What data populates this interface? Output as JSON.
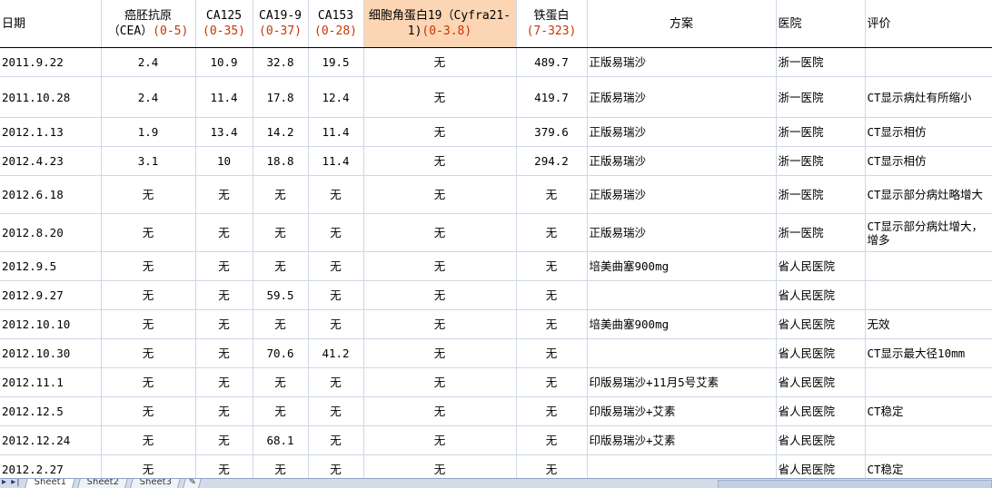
{
  "headers": {
    "date": "日期",
    "cea_line1": "癌胚抗原",
    "cea_line2_a": "（CEA）",
    "cea_line2_b": "(0-5)",
    "ca125": "CA125",
    "ca125_range": "(0-35)",
    "ca199": "CA19-9",
    "ca199_range": "(0-37)",
    "ca153": "CA153",
    "ca153_range": "(0-28)",
    "cyfra_line1": "细胞角蛋白19（Cyfra21-",
    "cyfra_line2_a": "1)",
    "cyfra_line2_b": "(0-3.8)",
    "ferritin": "铁蛋白",
    "ferritin_range": "(7-323)",
    "plan": "方案",
    "hospital": "医院",
    "evaluation": "评价"
  },
  "rows": [
    {
      "date": "2011.9.22",
      "cea": "2.4",
      "ca125": "10.9",
      "ca199": "32.8",
      "ca153": "19.5",
      "cyfra": "无",
      "ferritin": "489.7",
      "plan": "正版易瑞沙",
      "hospital": "浙一医院",
      "evaluation": ""
    },
    {
      "date": "2011.10.28",
      "cea": "2.4",
      "ca125": "11.4",
      "ca199": "17.8",
      "ca153": "12.4",
      "cyfra": "无",
      "ferritin": "419.7",
      "plan": "正版易瑞沙",
      "hospital": "浙一医院",
      "evaluation": "CT显示病灶有所缩小"
    },
    {
      "date": "2012.1.13",
      "cea": "1.9",
      "ca125": "13.4",
      "ca199": "14.2",
      "ca153": "11.4",
      "cyfra": "无",
      "ferritin": "379.6",
      "plan": "正版易瑞沙",
      "hospital": "浙一医院",
      "evaluation": "CT显示相仿"
    },
    {
      "date": "2012.4.23",
      "cea": "3.1",
      "ca125": "10",
      "ca199": "18.8",
      "ca153": "11.4",
      "cyfra": "无",
      "ferritin": "294.2",
      "plan": "正版易瑞沙",
      "hospital": "浙一医院",
      "evaluation": "CT显示相仿"
    },
    {
      "date": "2012.6.18",
      "cea": "无",
      "ca125": "无",
      "ca199": "无",
      "ca153": "无",
      "cyfra": "无",
      "ferritin": "无",
      "plan": "正版易瑞沙",
      "hospital": "浙一医院",
      "evaluation": "CT显示部分病灶略增大"
    },
    {
      "date": "2012.8.20",
      "cea": "无",
      "ca125": "无",
      "ca199": "无",
      "ca153": "无",
      "cyfra": "无",
      "ferritin": "无",
      "plan": "正版易瑞沙",
      "hospital": "浙一医院",
      "evaluation": "CT显示部分病灶增大，增多"
    },
    {
      "date": "2012.9.5",
      "cea": "无",
      "ca125": "无",
      "ca199": "无",
      "ca153": "无",
      "cyfra": "无",
      "ferritin": "无",
      "plan": "培美曲塞900mg",
      "hospital": "省人民医院",
      "evaluation": ""
    },
    {
      "date": "2012.9.27",
      "cea": "无",
      "ca125": "无",
      "ca199": "59.5",
      "ca153": "无",
      "cyfra": "无",
      "ferritin": "无",
      "plan": "",
      "hospital": "省人民医院",
      "evaluation": ""
    },
    {
      "date": "2012.10.10",
      "cea": "无",
      "ca125": "无",
      "ca199": "无",
      "ca153": "无",
      "cyfra": "无",
      "ferritin": "无",
      "plan": "培美曲塞900mg",
      "hospital": "省人民医院",
      "evaluation": "无效"
    },
    {
      "date": "2012.10.30",
      "cea": "无",
      "ca125": "无",
      "ca199": "70.6",
      "ca153": "41.2",
      "cyfra": "无",
      "ferritin": "无",
      "plan": "",
      "hospital": "省人民医院",
      "evaluation": "CT显示最大径10mm"
    },
    {
      "date": "2012.11.1",
      "cea": "无",
      "ca125": "无",
      "ca199": "无",
      "ca153": "无",
      "cyfra": "无",
      "ferritin": "无",
      "plan": "印版易瑞沙+11月5号艾素",
      "hospital": "省人民医院",
      "evaluation": ""
    },
    {
      "date": "2012.12.5",
      "cea": "无",
      "ca125": "无",
      "ca199": "无",
      "ca153": "无",
      "cyfra": "无",
      "ferritin": "无",
      "plan": "印版易瑞沙+艾素",
      "hospital": "省人民医院",
      "evaluation": "CT稳定"
    },
    {
      "date": "2012.12.24",
      "cea": "无",
      "ca125": "无",
      "ca199": "68.1",
      "ca153": "无",
      "cyfra": "无",
      "ferritin": "无",
      "plan": "印版易瑞沙+艾素",
      "hospital": "省人民医院",
      "evaluation": ""
    },
    {
      "date": "2012.2.27",
      "cea": "无",
      "ca125": "无",
      "ca199": "无",
      "ca153": "无",
      "cyfra": "无",
      "ferritin": "无",
      "plan": "",
      "hospital": "省人民医院",
      "evaluation": "CT稳定"
    }
  ],
  "tabs": [
    "Sheet1",
    "Sheet2",
    "Sheet3"
  ],
  "nav_glyph": "▸ ▸|"
}
